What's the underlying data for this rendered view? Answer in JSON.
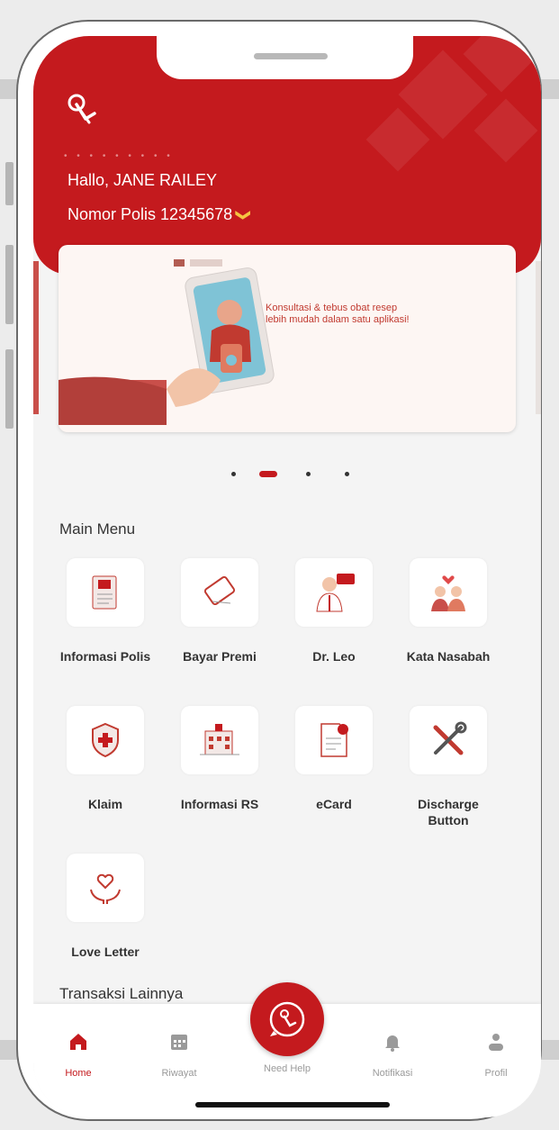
{
  "header": {
    "greeting": "Hallo, JANE RAILEY",
    "policy_label": "Nomor Polis 12345678",
    "policy_chevron": "❯"
  },
  "banner": {
    "headline": "Konsultasi & tebus obat resep lebih mudah dalam satu aplikasi!",
    "slides_total": 4,
    "active_slide": 2
  },
  "main_menu": {
    "title": "Main Menu",
    "items": [
      {
        "label": "Informasi Polis",
        "icon": "document-clipboard-icon"
      },
      {
        "label": "Bayar Premi",
        "icon": "card-payment-icon"
      },
      {
        "label": "Dr. Leo",
        "icon": "doctor-icon"
      },
      {
        "label": "Kata Nasabah",
        "icon": "family-love-icon"
      },
      {
        "label": "Klaim",
        "icon": "shield-plus-icon"
      },
      {
        "label": "Informasi RS",
        "icon": "hospital-building-icon"
      },
      {
        "label": "eCard",
        "icon": "ecard-icon"
      },
      {
        "label": "Discharge Button",
        "icon": "tools-icon"
      },
      {
        "label": "Love Letter",
        "icon": "heart-hands-icon"
      }
    ]
  },
  "other_transactions": {
    "title": "Transaksi Lainnya"
  },
  "bottom_nav": {
    "items": [
      {
        "label": "Home",
        "icon": "home-icon",
        "active": true
      },
      {
        "label": "Riwayat",
        "icon": "calendar-icon",
        "active": false
      },
      {
        "label": "Need Help",
        "icon": "help-hand-icon",
        "active": false
      },
      {
        "label": "Notifikasi",
        "icon": "bell-icon",
        "active": false
      },
      {
        "label": "Profil",
        "icon": "user-icon",
        "active": false
      }
    ]
  },
  "colors": {
    "brand_red": "#c41a1e",
    "background": "#f4f4f4",
    "inactive_gray": "#9a9a9a"
  }
}
